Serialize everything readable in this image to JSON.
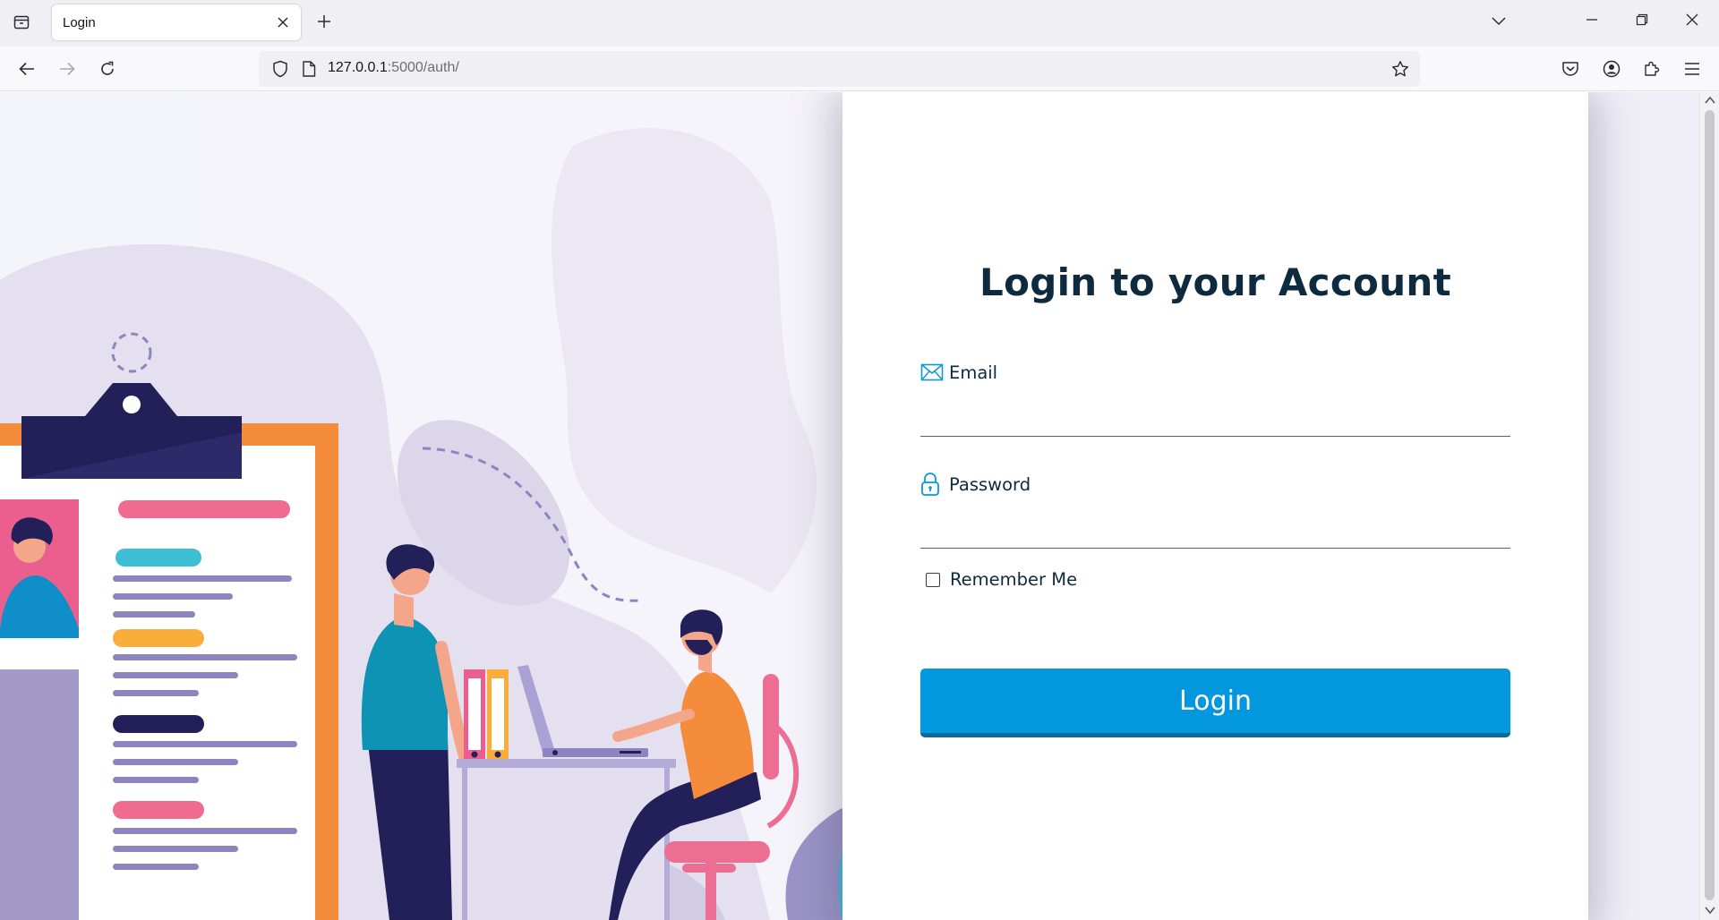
{
  "browser": {
    "tab": {
      "title": "Login",
      "close_icon": "close-icon"
    },
    "url": {
      "host": "127.0.0.1",
      "rest": ":5000/auth/"
    },
    "icons": [
      "tab-list-icon",
      "plus-icon",
      "chevron-down-icon",
      "minimize-icon",
      "restore-icon",
      "close-icon",
      "back-arrow-icon",
      "forward-arrow-icon",
      "reload-icon",
      "shield-icon",
      "page-icon",
      "star-icon",
      "pocket-icon",
      "account-icon",
      "extensions-icon",
      "hamburger-menu-icon"
    ]
  },
  "login": {
    "title": "Login to your Account",
    "email_label": "Email",
    "email_value": "",
    "password_label": "Password",
    "password_value": "",
    "remember_label": "Remember Me",
    "remember_checked": false,
    "button_label": "Login"
  },
  "colors": {
    "accent": "#0398de",
    "title_text": "#0e2a3f"
  }
}
